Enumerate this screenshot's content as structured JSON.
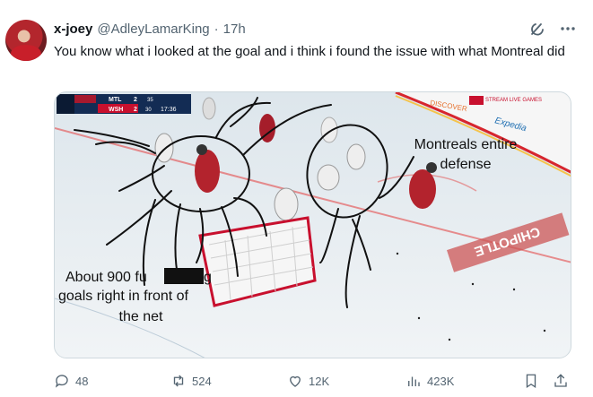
{
  "tweet": {
    "display_name": "x-joey",
    "handle": "@AdleyLamarKing",
    "separator": "·",
    "time": "17h",
    "text": "You know what i looked at the goal and i think i found the issue with what Montreal did"
  },
  "media": {
    "scoreboard": {
      "team1": "MTL",
      "score1": "2",
      "team2": "WSH",
      "score2": "2",
      "shots": "30",
      "clock": "17:36",
      "period_badge": "35"
    },
    "board_ads": [
      "DISCOVER",
      "STREAM LIVE GAMES",
      "Expedia"
    ],
    "ice_ad": "CHIPOTLE",
    "annotation_right": [
      "Montreals entire",
      "defense"
    ],
    "annotation_left": [
      "About 900 fu",
      "g",
      "goals right in front of",
      "the net"
    ]
  },
  "actions": {
    "replies": "48",
    "reposts": "524",
    "likes": "12K",
    "views": "423K"
  },
  "colors": {
    "accent": "#1d9bf0",
    "muted": "#536471",
    "text": "#0f1419",
    "team_red": "#c8102e"
  }
}
